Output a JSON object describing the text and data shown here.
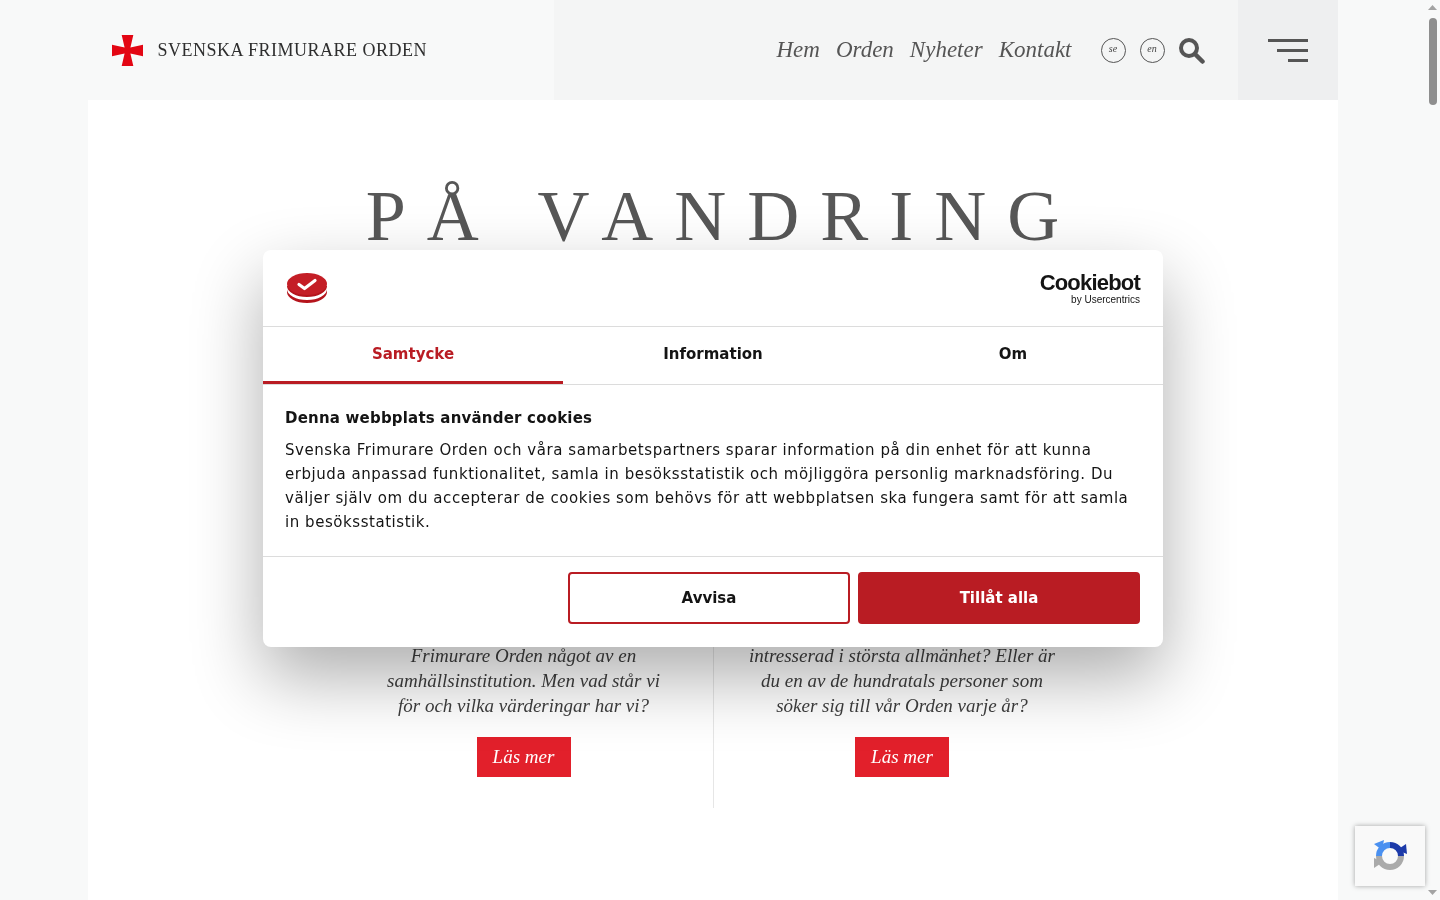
{
  "header": {
    "logo_text": "SVENSKA FRIMURARE ORDEN",
    "nav": [
      {
        "label": "Hem"
      },
      {
        "label": "Orden"
      },
      {
        "label": "Nyheter"
      },
      {
        "label": "Kontakt"
      }
    ],
    "languages": [
      {
        "code": "se"
      },
      {
        "code": "en"
      }
    ]
  },
  "hero": {
    "title": "PÅ VANDRING"
  },
  "cards": [
    {
      "lines": [
        "Frimurare Orden något av en",
        "samhällsinstitution. Men vad står vi",
        "för och vilka värderingar har vi?"
      ],
      "button": "Läs mer"
    },
    {
      "lines": [
        "intresserad i största allmänhet? Eller är",
        "du en av de hundratals personer som",
        "söker sig till vår Orden varje år?"
      ],
      "button": "Läs mer"
    }
  ],
  "cookie_dialog": {
    "brand": {
      "name": "Cookiebot",
      "byline": "by Usercentrics"
    },
    "tabs": [
      {
        "label": "Samtycke",
        "selected": true
      },
      {
        "label": "Information",
        "selected": false
      },
      {
        "label": "Om",
        "selected": false
      }
    ],
    "heading": "Denna webbplats använder cookies",
    "body": "Svenska Frimurare Orden och våra samarbetspartners sparar information på din enhet för att kunna erbjuda anpassad funktionalitet, samla in besöksstatistik och möjliggöra personlig marknadsföring. Du väljer själv om du accepterar de cookies som behövs för att webbplatsen ska fungera samt för att samla in besöksstatistik.",
    "buttons": [
      {
        "label": "Avvisa",
        "kind": "outline"
      },
      {
        "label": "Tillåt alla",
        "kind": "primary"
      }
    ]
  }
}
